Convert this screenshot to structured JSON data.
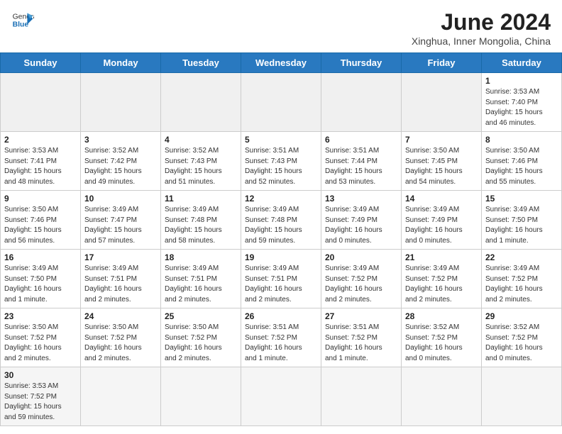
{
  "header": {
    "logo_general": "General",
    "logo_blue": "Blue",
    "month_title": "June 2024",
    "location": "Xinghua, Inner Mongolia, China"
  },
  "weekdays": [
    "Sunday",
    "Monday",
    "Tuesday",
    "Wednesday",
    "Thursday",
    "Friday",
    "Saturday"
  ],
  "weeks": [
    [
      {
        "day": "",
        "info": ""
      },
      {
        "day": "",
        "info": ""
      },
      {
        "day": "",
        "info": ""
      },
      {
        "day": "",
        "info": ""
      },
      {
        "day": "",
        "info": ""
      },
      {
        "day": "",
        "info": ""
      },
      {
        "day": "1",
        "info": "Sunrise: 3:53 AM\nSunset: 7:40 PM\nDaylight: 15 hours\nand 46 minutes."
      }
    ],
    [
      {
        "day": "2",
        "info": "Sunrise: 3:53 AM\nSunset: 7:41 PM\nDaylight: 15 hours\nand 48 minutes."
      },
      {
        "day": "3",
        "info": "Sunrise: 3:52 AM\nSunset: 7:42 PM\nDaylight: 15 hours\nand 49 minutes."
      },
      {
        "day": "4",
        "info": "Sunrise: 3:52 AM\nSunset: 7:43 PM\nDaylight: 15 hours\nand 51 minutes."
      },
      {
        "day": "5",
        "info": "Sunrise: 3:51 AM\nSunset: 7:43 PM\nDaylight: 15 hours\nand 52 minutes."
      },
      {
        "day": "6",
        "info": "Sunrise: 3:51 AM\nSunset: 7:44 PM\nDaylight: 15 hours\nand 53 minutes."
      },
      {
        "day": "7",
        "info": "Sunrise: 3:50 AM\nSunset: 7:45 PM\nDaylight: 15 hours\nand 54 minutes."
      },
      {
        "day": "8",
        "info": "Sunrise: 3:50 AM\nSunset: 7:46 PM\nDaylight: 15 hours\nand 55 minutes."
      }
    ],
    [
      {
        "day": "9",
        "info": "Sunrise: 3:50 AM\nSunset: 7:46 PM\nDaylight: 15 hours\nand 56 minutes."
      },
      {
        "day": "10",
        "info": "Sunrise: 3:49 AM\nSunset: 7:47 PM\nDaylight: 15 hours\nand 57 minutes."
      },
      {
        "day": "11",
        "info": "Sunrise: 3:49 AM\nSunset: 7:48 PM\nDaylight: 15 hours\nand 58 minutes."
      },
      {
        "day": "12",
        "info": "Sunrise: 3:49 AM\nSunset: 7:48 PM\nDaylight: 15 hours\nand 59 minutes."
      },
      {
        "day": "13",
        "info": "Sunrise: 3:49 AM\nSunset: 7:49 PM\nDaylight: 16 hours\nand 0 minutes."
      },
      {
        "day": "14",
        "info": "Sunrise: 3:49 AM\nSunset: 7:49 PM\nDaylight: 16 hours\nand 0 minutes."
      },
      {
        "day": "15",
        "info": "Sunrise: 3:49 AM\nSunset: 7:50 PM\nDaylight: 16 hours\nand 1 minute."
      }
    ],
    [
      {
        "day": "16",
        "info": "Sunrise: 3:49 AM\nSunset: 7:50 PM\nDaylight: 16 hours\nand 1 minute."
      },
      {
        "day": "17",
        "info": "Sunrise: 3:49 AM\nSunset: 7:51 PM\nDaylight: 16 hours\nand 2 minutes."
      },
      {
        "day": "18",
        "info": "Sunrise: 3:49 AM\nSunset: 7:51 PM\nDaylight: 16 hours\nand 2 minutes."
      },
      {
        "day": "19",
        "info": "Sunrise: 3:49 AM\nSunset: 7:51 PM\nDaylight: 16 hours\nand 2 minutes."
      },
      {
        "day": "20",
        "info": "Sunrise: 3:49 AM\nSunset: 7:52 PM\nDaylight: 16 hours\nand 2 minutes."
      },
      {
        "day": "21",
        "info": "Sunrise: 3:49 AM\nSunset: 7:52 PM\nDaylight: 16 hours\nand 2 minutes."
      },
      {
        "day": "22",
        "info": "Sunrise: 3:49 AM\nSunset: 7:52 PM\nDaylight: 16 hours\nand 2 minutes."
      }
    ],
    [
      {
        "day": "23",
        "info": "Sunrise: 3:50 AM\nSunset: 7:52 PM\nDaylight: 16 hours\nand 2 minutes."
      },
      {
        "day": "24",
        "info": "Sunrise: 3:50 AM\nSunset: 7:52 PM\nDaylight: 16 hours\nand 2 minutes."
      },
      {
        "day": "25",
        "info": "Sunrise: 3:50 AM\nSunset: 7:52 PM\nDaylight: 16 hours\nand 2 minutes."
      },
      {
        "day": "26",
        "info": "Sunrise: 3:51 AM\nSunset: 7:52 PM\nDaylight: 16 hours\nand 1 minute."
      },
      {
        "day": "27",
        "info": "Sunrise: 3:51 AM\nSunset: 7:52 PM\nDaylight: 16 hours\nand 1 minute."
      },
      {
        "day": "28",
        "info": "Sunrise: 3:52 AM\nSunset: 7:52 PM\nDaylight: 16 hours\nand 0 minutes."
      },
      {
        "day": "29",
        "info": "Sunrise: 3:52 AM\nSunset: 7:52 PM\nDaylight: 16 hours\nand 0 minutes."
      }
    ],
    [
      {
        "day": "30",
        "info": "Sunrise: 3:53 AM\nSunset: 7:52 PM\nDaylight: 15 hours\nand 59 minutes."
      },
      {
        "day": "",
        "info": ""
      },
      {
        "day": "",
        "info": ""
      },
      {
        "day": "",
        "info": ""
      },
      {
        "day": "",
        "info": ""
      },
      {
        "day": "",
        "info": ""
      },
      {
        "day": "",
        "info": ""
      }
    ]
  ]
}
